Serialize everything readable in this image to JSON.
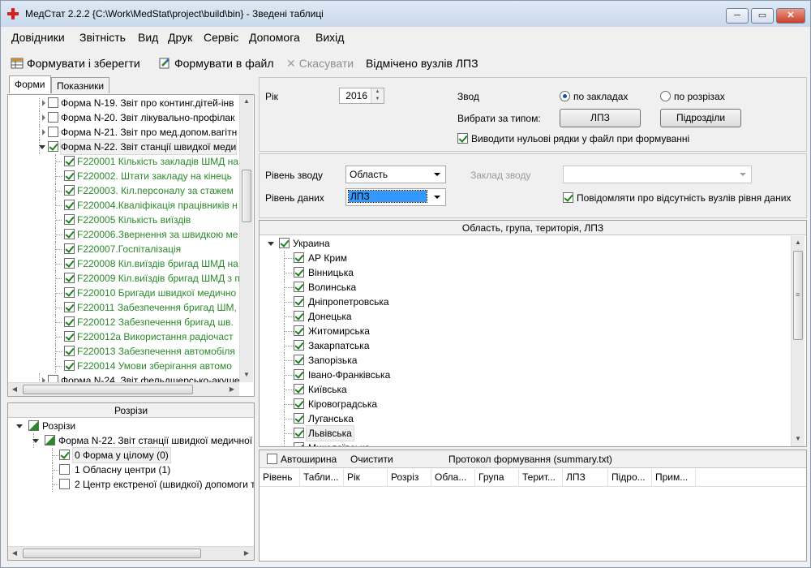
{
  "window": {
    "title": "МедСтат 2.2.2  {C:\\Work\\MedStat\\project\\build\\bin} - Зведені таблиці",
    "controls": {
      "minimize": "─",
      "maximize": "▭",
      "close": "✕"
    }
  },
  "menu": [
    "Довідники",
    "Звітність",
    "Вид",
    "Друк",
    "Сервіс",
    "Допомога",
    "Вихід"
  ],
  "toolbar": {
    "form_save": "Формувати і зберегти",
    "form_file": "Формувати в файл",
    "cancel": "Скасувати",
    "status": "Відмічено вузлів ЛПЗ"
  },
  "tabs": {
    "forms": "Форми",
    "indicators": "Показники"
  },
  "forms_tree": [
    {
      "label": "Форма N-19. Звіт про континг.дітей-інв",
      "level": 0,
      "checked": false,
      "expand": "collapsed",
      "green": false
    },
    {
      "label": "Форма N-20. Звіт лікувально-профілак",
      "level": 0,
      "checked": false,
      "expand": "collapsed",
      "green": false
    },
    {
      "label": "Форма N-21. Звіт про мед.допом.вагітн",
      "level": 0,
      "checked": false,
      "expand": "collapsed",
      "green": false
    },
    {
      "label": "Форма N-22. Звіт станції швидкої меди",
      "level": 0,
      "checked": true,
      "expand": "expanded",
      "green": false
    },
    {
      "label": "F220001 Кількість закладів ШМД на",
      "level": 1,
      "checked": true,
      "green": true
    },
    {
      "label": "F220002.  Штати закладу  на кінець",
      "level": 1,
      "checked": true,
      "green": true
    },
    {
      "label": "F220003. Кіл.персоналу за стажем",
      "level": 1,
      "checked": true,
      "green": true
    },
    {
      "label": "F220004.Кваліфікація працівників н",
      "level": 1,
      "checked": true,
      "green": true
    },
    {
      "label": "F220005 Кількість виїздів",
      "level": 1,
      "checked": true,
      "green": true
    },
    {
      "label": "F220006.Звернення за швидкою ме",
      "level": 1,
      "checked": true,
      "green": true
    },
    {
      "label": "F220007.Госпіталізація",
      "level": 1,
      "checked": true,
      "green": true
    },
    {
      "label": "F220008 Кіл.виїздів бригад ШМД на",
      "level": 1,
      "checked": true,
      "green": true
    },
    {
      "label": "F220009 Кіл.виїздів бригад ШМД з п",
      "level": 1,
      "checked": true,
      "green": true
    },
    {
      "label": "F220010 Бригади швидкої медично",
      "level": 1,
      "checked": true,
      "green": true
    },
    {
      "label": "F220011 Забезпечення бригад ШМ,",
      "level": 1,
      "checked": true,
      "green": true
    },
    {
      "label": "F220012 Забезпечення бригад шв.",
      "level": 1,
      "checked": true,
      "green": true
    },
    {
      "label": "F220012а Використання радіочаст",
      "level": 1,
      "checked": true,
      "green": true
    },
    {
      "label": "F220013 Забезпечення автомобіля",
      "level": 1,
      "checked": true,
      "green": true
    },
    {
      "label": "F220014 Умови зберігання автомо",
      "level": 1,
      "checked": true,
      "green": true
    },
    {
      "label": "Форма N-24. Звіт фельдшерсько-акуше",
      "level": 0,
      "checked": false,
      "expand": "collapsed",
      "green": false
    }
  ],
  "sections": {
    "caption": "Розрізи",
    "root": "Розрізи",
    "form": "Форма N-22. Звіт станції швидкої медичної",
    "items": [
      {
        "label": "0 Форма у цілому (0)",
        "checked": true,
        "selected": true
      },
      {
        "label": "1 Обласну центри (1)",
        "checked": false,
        "selected": false
      },
      {
        "label": "2 Центр екстреної (швидкої) допомоги т",
        "checked": false,
        "selected": false
      }
    ]
  },
  "params": {
    "year_label": "Рік",
    "year_value": "2016",
    "zvod_label": "Звод",
    "radio_institutions": "по закладах",
    "radio_sections": "по розрізах",
    "radio_selected": "institutions",
    "choose_by_type": "Вибрати за типом:",
    "btn_lpz": "ЛПЗ",
    "btn_subdivisions": "Підрозділи",
    "zero_rows": "Виводити нульові рядки у файл при формуванні",
    "zero_rows_checked": true,
    "level_zvod_label": "Рівень зводу",
    "level_zvod_value": "Область",
    "institution_zvod_label": "Заклад зводу",
    "institution_zvod_value": "",
    "level_data_label": "Рівень даних",
    "level_data_value": "ЛПЗ",
    "notify_missing": "Повідомляти про відсутність вузлів рівня даних",
    "notify_checked": true
  },
  "regions": {
    "caption": "Область, група, територія, ЛПЗ",
    "root": "Украина",
    "items": [
      "АР Крим",
      "Вінницька",
      "Волинська",
      "Дніпропетровська",
      "Донецька",
      "Житомирська",
      "Закарпатська",
      "Запорізька",
      "Івано-Франківська",
      "Київська",
      "Кіровоградська",
      "Луганська",
      "Львівська",
      "Миколаївська"
    ],
    "selected_index": 12
  },
  "protocol": {
    "autowidth": "Автоширина",
    "clear": "Очистити",
    "title": "Протокол формування (summary.txt)",
    "columns": [
      "Рівень",
      "Табли...",
      "Рік",
      "Розріз",
      "Обла...",
      "Група",
      "Терит...",
      "ЛПЗ",
      "Підро...",
      "Прим..."
    ]
  }
}
